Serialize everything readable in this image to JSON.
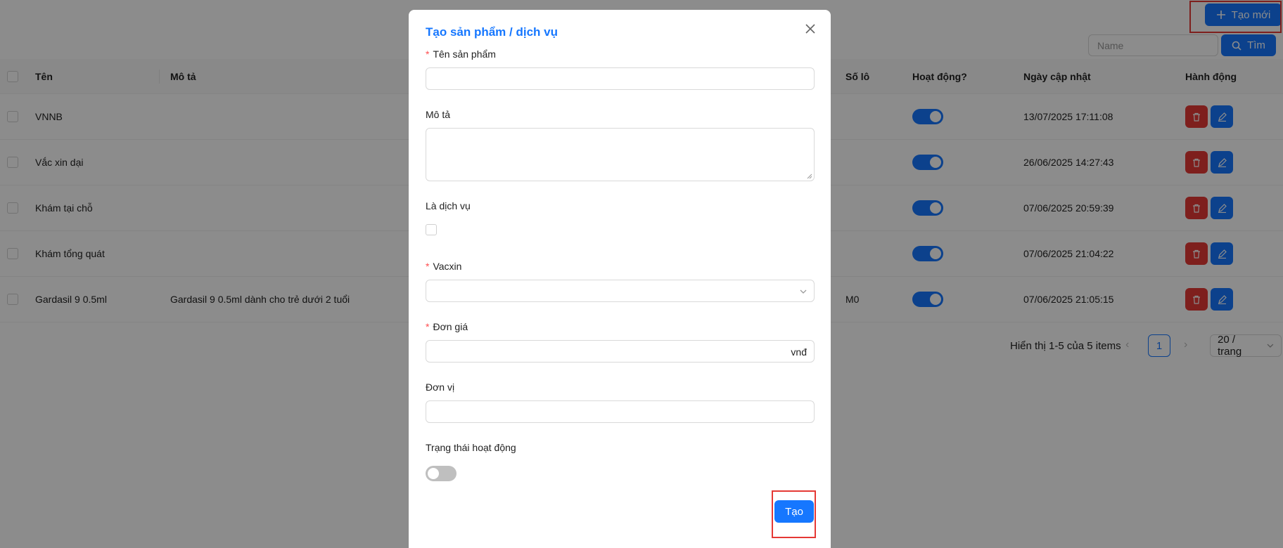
{
  "toolbar": {
    "create_new_label": "Tạo mới",
    "search_placeholder": "Name",
    "search_label": "Tìm"
  },
  "table": {
    "columns": [
      "Tên",
      "Mô tả",
      "Số lô",
      "Hoạt động?",
      "Ngày cập nhật",
      "Hành động"
    ],
    "rows": [
      {
        "name": "VNNB",
        "description": "",
        "lot": "",
        "active": true,
        "updated": "13/07/2025 17:11:08"
      },
      {
        "name": "Vắc xin dại",
        "description": "",
        "lot": "",
        "active": true,
        "updated": "26/06/2025 14:27:43"
      },
      {
        "name": "Khám tại chỗ",
        "description": "",
        "lot": "",
        "active": true,
        "updated": "07/06/2025 20:59:39"
      },
      {
        "name": "Khám tổng quát",
        "description": "",
        "lot": "",
        "active": true,
        "updated": "07/06/2025 21:04:22"
      },
      {
        "name": "Gardasil 9 0.5ml",
        "description": "Gardasil 9 0.5ml dành cho trẻ dưới 2 tuổi",
        "lot": "M0",
        "active": true,
        "updated": "07/06/2025 21:05:15"
      }
    ]
  },
  "pagination": {
    "summary": "Hiển thị 1-5 của 5 items",
    "current_page": "1",
    "page_size": "20 / trang"
  },
  "modal": {
    "title": "Tạo sản phẩm / dịch vụ",
    "fields": {
      "name": {
        "label": "Tên sản phẩm",
        "required": true,
        "value": ""
      },
      "description": {
        "label": "Mô tả",
        "required": false,
        "value": ""
      },
      "is_service": {
        "label": "Là dịch vụ",
        "checked": false
      },
      "vaccine": {
        "label": "Vacxin",
        "required": true,
        "value": ""
      },
      "price": {
        "label": "Đơn giá",
        "required": true,
        "value": "",
        "suffix": "vnđ"
      },
      "unit": {
        "label": "Đơn vị",
        "required": false,
        "value": ""
      },
      "status": {
        "label": "Trạng thái hoạt động",
        "on": false
      }
    },
    "submit_label": "Tạo"
  },
  "colors": {
    "primary": "#1677ff",
    "danger": "#e53935",
    "highlight": "#e53935"
  }
}
